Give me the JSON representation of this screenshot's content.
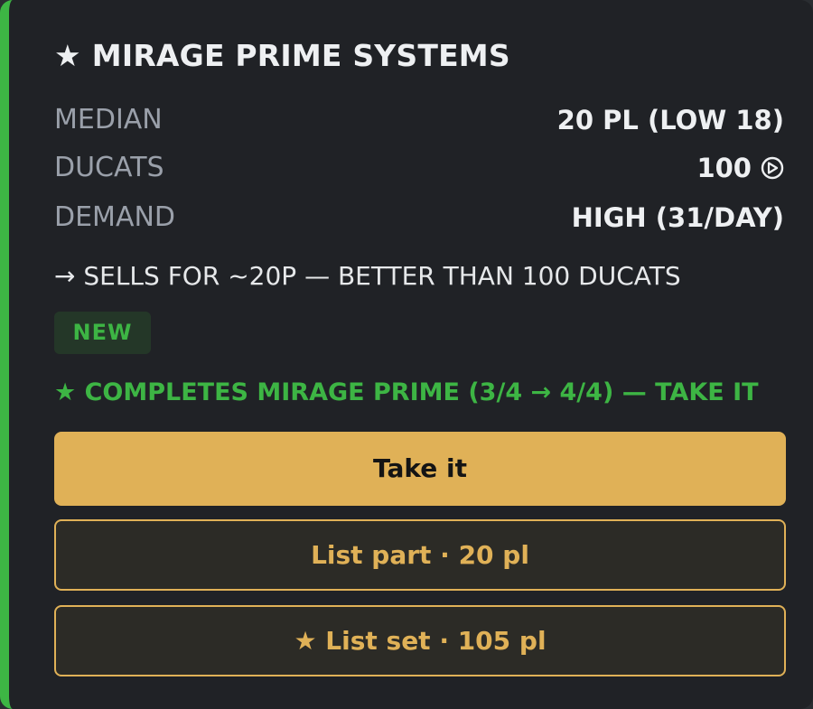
{
  "item": {
    "title": "MIRAGE PRIME SYSTEMS",
    "star_icon": "★"
  },
  "stats": [
    {
      "label": "MEDIAN",
      "value": "20 PL (LOW 18)"
    },
    {
      "label": "DUCATS",
      "value": "100",
      "icon": "ducat-icon"
    },
    {
      "label": "DEMAND",
      "value": "HIGH (31/DAY)"
    }
  ],
  "advice": "→ SELLS FOR ~20P — BETTER THAN 100 DUCATS",
  "badge": "NEW",
  "completes": "★ COMPLETES MIRAGE PRIME (3/4 → 4/4) — TAKE IT",
  "buttons": {
    "take": "Take it",
    "list_part": "List part · 20 pl",
    "list_set": "★ List set · 105 pl"
  },
  "colors": {
    "accent_green": "#3db544",
    "accent_gold": "#e0b157",
    "card_bg": "#202226"
  }
}
